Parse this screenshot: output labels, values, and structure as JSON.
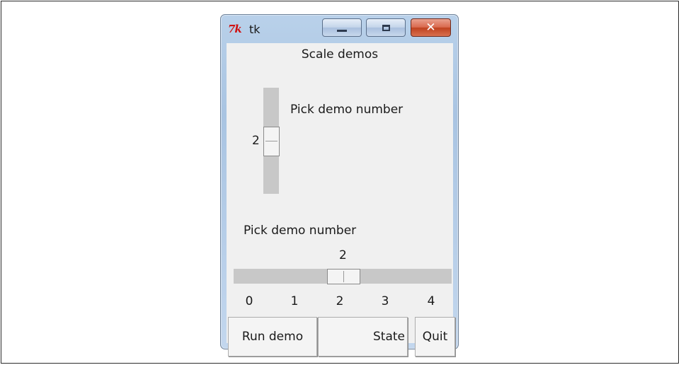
{
  "window": {
    "title": "tk",
    "logo_text": "7k",
    "controls": {
      "minimize_icon": "minimize-icon",
      "maximize_icon": "maximize-icon",
      "close_glyph": "✕"
    }
  },
  "content": {
    "heading": "Scale demos",
    "vertical_scale": {
      "label": "Pick demo number",
      "value": "2",
      "min": 0,
      "max": 4
    },
    "horizontal_scale": {
      "label": "Pick demo number",
      "value": "2",
      "ticks": [
        "0",
        "1",
        "2",
        "3",
        "4"
      ]
    },
    "buttons": {
      "run": "Run demo",
      "state": "State",
      "quit": "Quit"
    }
  },
  "colors": {
    "close_button": "#c9502f",
    "trough": "#c8c8c8",
    "client_bg": "#f0f0f0"
  }
}
